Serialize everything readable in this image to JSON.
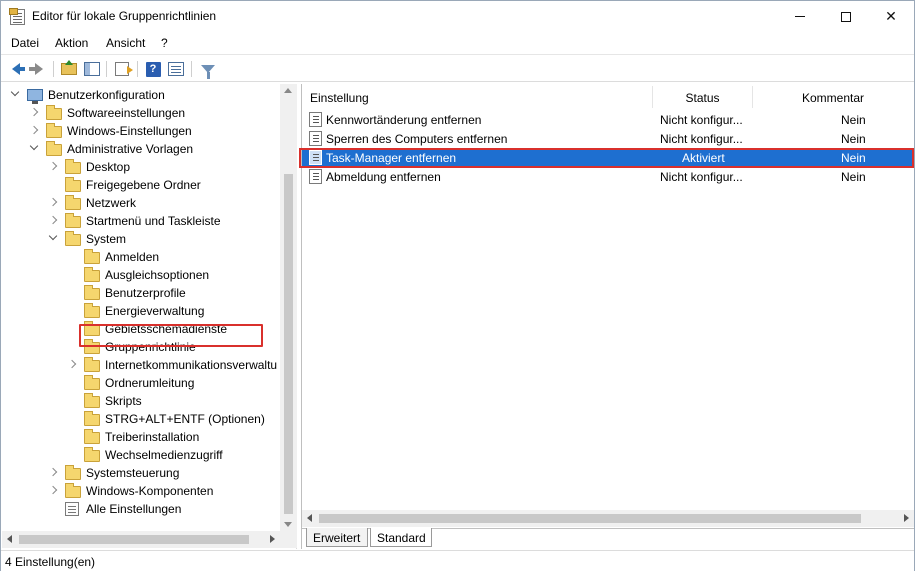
{
  "window": {
    "title": "Editor für lokale Gruppenrichtlinien",
    "minimize_icon": "minimize-icon",
    "maximize_icon": "maximize-icon",
    "close_glyph": "✕"
  },
  "menu": [
    "Datei",
    "Aktion",
    "Ansicht",
    "?"
  ],
  "toolbar": {
    "icons": [
      "back-arrow-icon",
      "forward-arrow-icon",
      "up-folder-icon",
      "show-hide-tree-icon",
      "export-list-icon",
      "help-icon",
      "properties-icon",
      "filter-icon"
    ],
    "help_glyph": "?"
  },
  "tree": [
    {
      "label": "Benutzerkonfiguration",
      "expander": "down",
      "icon": "computer-icon"
    },
    {
      "label": "Softwareeinstellungen",
      "expander": "right",
      "icon": "folder-icon"
    },
    {
      "label": "Windows-Einstellungen",
      "expander": "right",
      "icon": "folder-icon"
    },
    {
      "label": "Administrative Vorlagen",
      "expander": "down",
      "icon": "folder-icon"
    },
    {
      "label": "Desktop",
      "expander": "right",
      "icon": "folder-icon"
    },
    {
      "label": "Freigegebene Ordner",
      "expander": "",
      "icon": "folder-icon"
    },
    {
      "label": "Netzwerk",
      "expander": "right",
      "icon": "folder-icon"
    },
    {
      "label": "Startmenü und Taskleiste",
      "expander": "right",
      "icon": "folder-icon"
    },
    {
      "label": "System",
      "expander": "down",
      "icon": "folder-icon"
    },
    {
      "label": "Anmelden",
      "expander": "",
      "icon": "folder-icon"
    },
    {
      "label": "Ausgleichsoptionen",
      "expander": "",
      "icon": "folder-icon"
    },
    {
      "label": "Benutzerprofile",
      "expander": "",
      "icon": "folder-icon"
    },
    {
      "label": "Energieverwaltung",
      "expander": "",
      "icon": "folder-icon"
    },
    {
      "label": "Gebietsschemadienste",
      "expander": "",
      "icon": "folder-icon"
    },
    {
      "label": "Gruppenrichtlinie",
      "expander": "",
      "icon": "folder-icon"
    },
    {
      "label": "Internetkommunikationsverwaltu",
      "expander": "right",
      "icon": "folder-icon"
    },
    {
      "label": "Ordnerumleitung",
      "expander": "",
      "icon": "folder-icon"
    },
    {
      "label": "Skripts",
      "expander": "",
      "icon": "folder-icon"
    },
    {
      "label": "STRG+ALT+ENTF (Optionen)",
      "expander": "",
      "icon": "folder-icon",
      "selected": true
    },
    {
      "label": "Treiberinstallation",
      "expander": "",
      "icon": "folder-icon"
    },
    {
      "label": "Wechselmedienzugriff",
      "expander": "",
      "icon": "folder-icon"
    },
    {
      "label": "Systemsteuerung",
      "expander": "right",
      "icon": "folder-icon"
    },
    {
      "label": "Windows-Komponenten",
      "expander": "right",
      "icon": "folder-icon"
    },
    {
      "label": "Alle Einstellungen",
      "expander": "",
      "icon": "all-settings-icon"
    }
  ],
  "list": {
    "columns": {
      "setting": "Einstellung",
      "status": "Status",
      "comment": "Kommentar"
    },
    "rows": [
      {
        "setting": "Kennwortänderung entfernen",
        "status": "Nicht konfigur...",
        "comment": "Nein",
        "selected": false
      },
      {
        "setting": "Sperren des Computers entfernen",
        "status": "Nicht konfigur...",
        "comment": "Nein",
        "selected": false
      },
      {
        "setting": "Task-Manager entfernen",
        "status": "Aktiviert",
        "comment": "Nein",
        "selected": true
      },
      {
        "setting": "Abmeldung entfernen",
        "status": "Nicht konfigur...",
        "comment": "Nein",
        "selected": false
      }
    ]
  },
  "tabs": [
    "Erweitert",
    "Standard"
  ],
  "status_bar": "4 Einstellung(en)",
  "colors": {
    "selection": "#1e6fd0",
    "highlight_border": "#d9302c",
    "folder": "#f5d66e"
  }
}
